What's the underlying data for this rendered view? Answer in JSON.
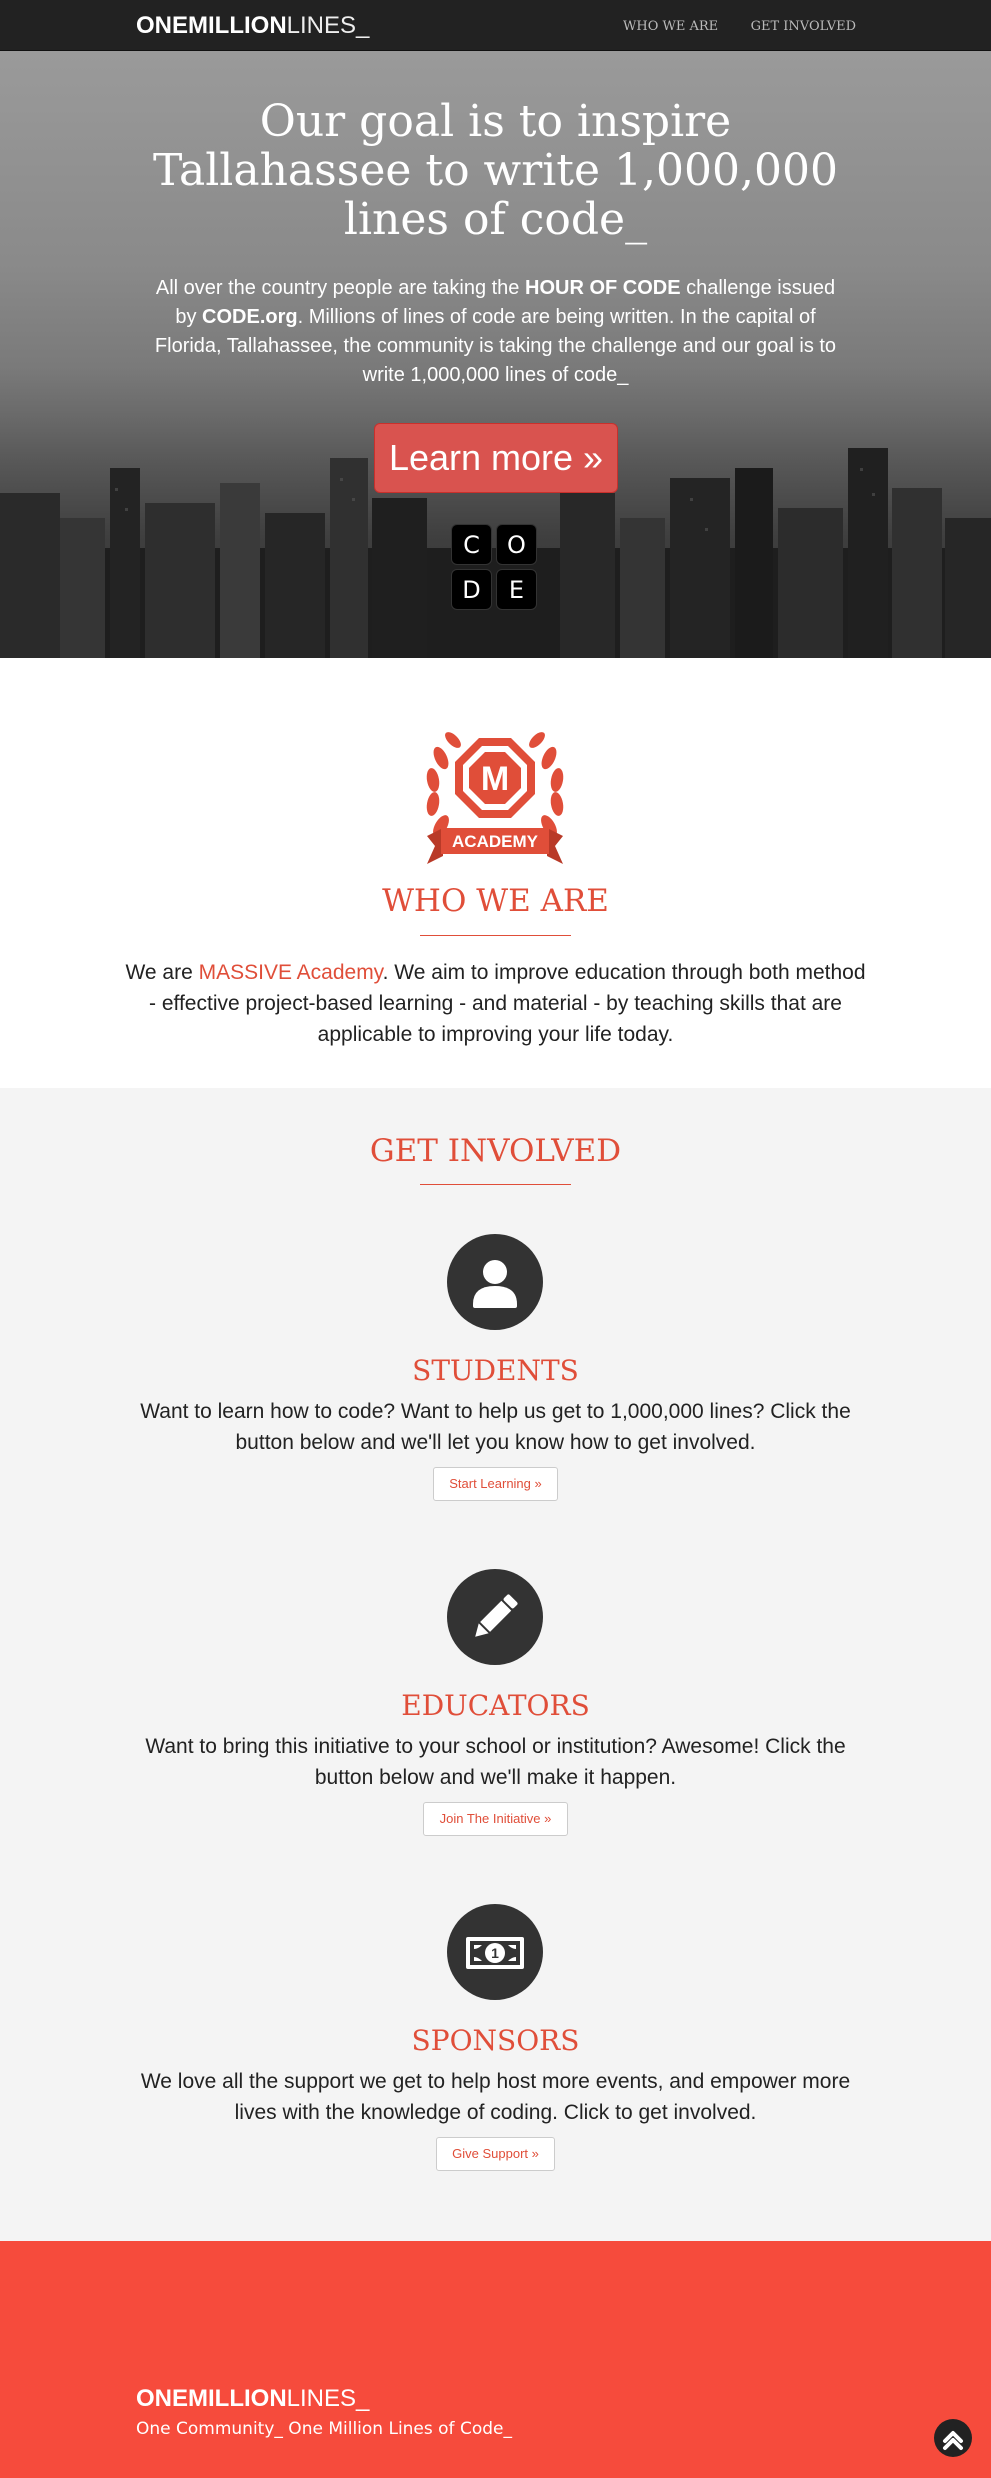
{
  "navbar": {
    "brand_bold": "ONEMILLION",
    "brand_light": "LINES_",
    "links": [
      "WHO WE ARE",
      "GET INVOLVED"
    ]
  },
  "hero": {
    "title": "Our goal is to inspire Tallahassee to write 1,000,000 lines of code_",
    "text_1": "All over the country people are taking the ",
    "text_bold_1": "HOUR OF CODE",
    "text_2": " challenge issued by ",
    "text_bold_2": "CODE.org",
    "text_3": ". Millions of lines of code are being written. In the capital of Florida, Tallahassee, the community is taking the challenge and our goal is to write 1,000,000 lines of code_",
    "button_label": "Learn more »",
    "code_tiles": [
      "C",
      "O",
      "D",
      "E"
    ]
  },
  "who": {
    "logo_letter": "M",
    "logo_banner": "ACADEMY",
    "title": "WHO WE ARE",
    "text_1": "We are ",
    "text_link": "MASSIVE Academy",
    "text_2": ". We aim to improve education through both method - effective project-based learning - and material - by teaching skills that are applicable to improving your life today."
  },
  "involved": {
    "title": "GET INVOLVED",
    "students": {
      "title": "STUDENTS",
      "text": "Want to learn how to code? Want to help us get to 1,000,000 lines? Click the button below and we'll let you know how to get involved.",
      "button": "Start Learning »",
      "icon": "user-icon"
    },
    "educators": {
      "title": "EDUCATORS",
      "text": "Want to bring this initiative to your school or institution? Awesome! Click the button below and we'll make it happen.",
      "button": "Join The Initiative »",
      "icon": "pencil-icon"
    },
    "sponsors": {
      "title": "SPONSORS",
      "text": "We love all the support we get to help host more events, and empower more lives with the knowledge of coding. Click to get involved.",
      "button": "Give Support »",
      "icon": "money-icon"
    }
  },
  "footer": {
    "brand_bold": "ONEMILLION",
    "brand_light": "LINES_",
    "tagline": "One Community_ One Million Lines of Code_"
  },
  "colors": {
    "accent": "#e04e39",
    "footer_bg": "#f64b3c",
    "navbar_bg": "#222222",
    "button_red": "#d9534f"
  }
}
